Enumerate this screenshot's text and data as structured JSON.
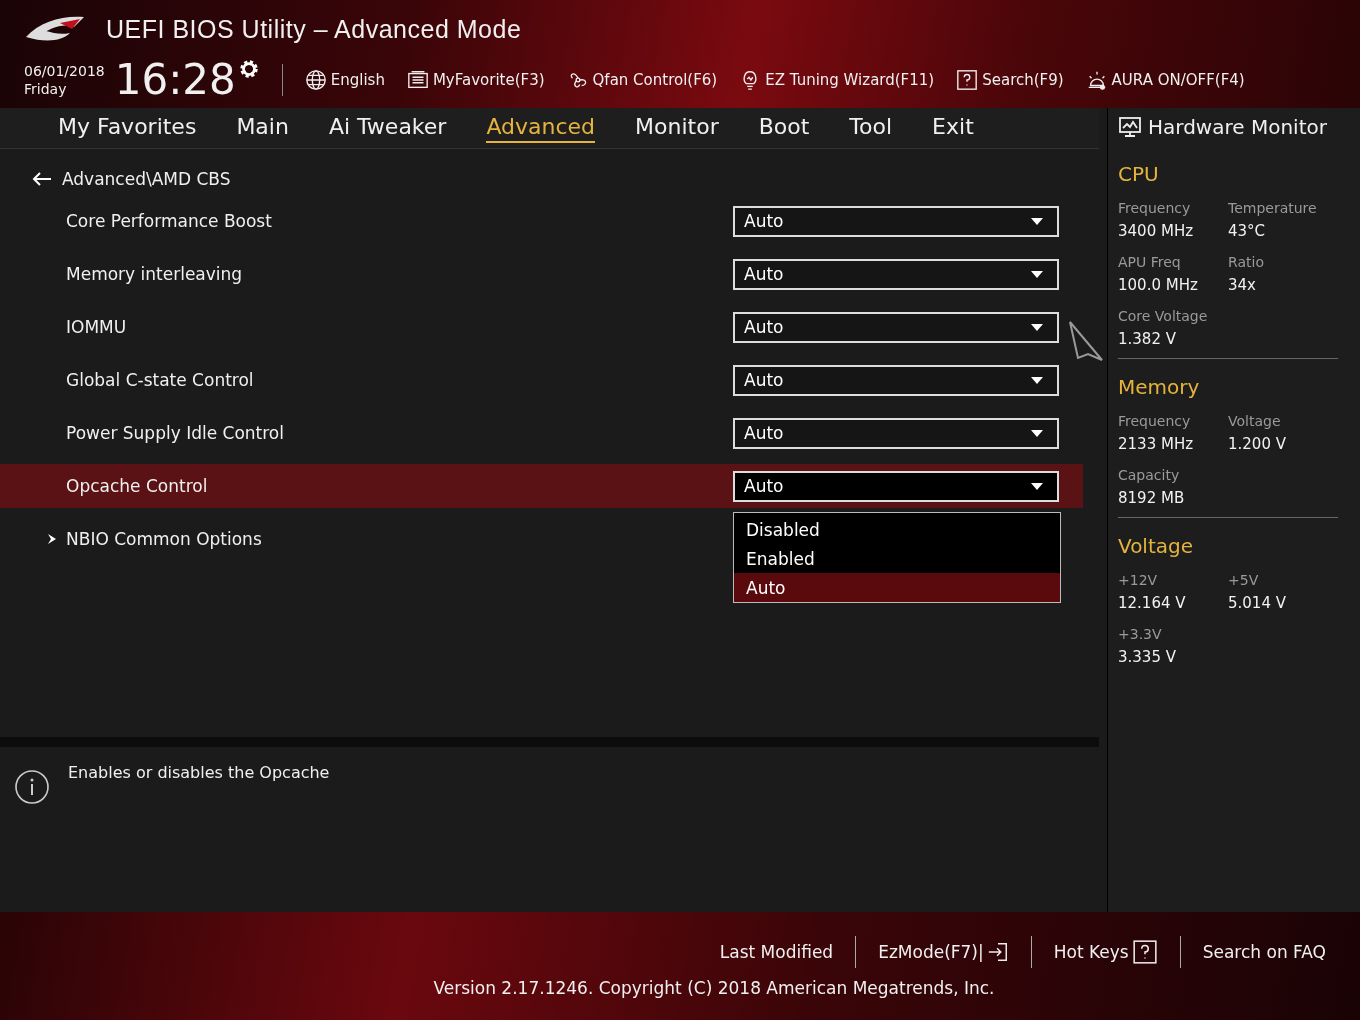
{
  "window": {
    "title": "UEFI BIOS Utility – Advanced Mode"
  },
  "clock": {
    "date": "06/01/2018",
    "day": "Friday",
    "time": "16:28"
  },
  "toolbar": [
    {
      "kind": "language",
      "label": "English"
    },
    {
      "kind": "favorite",
      "label": "MyFavorite(F3)"
    },
    {
      "kind": "fan",
      "label": "Qfan Control(F6)"
    },
    {
      "kind": "wizard",
      "label": "EZ Tuning Wizard(F11)"
    },
    {
      "kind": "search",
      "label": "Search(F9)"
    },
    {
      "kind": "aura",
      "label": "AURA ON/OFF(F4)"
    }
  ],
  "tabs": [
    {
      "label": "My Favorites",
      "selected": false
    },
    {
      "label": "Main",
      "selected": false
    },
    {
      "label": "Ai Tweaker",
      "selected": false
    },
    {
      "label": "Advanced",
      "selected": true
    },
    {
      "label": "Monitor",
      "selected": false
    },
    {
      "label": "Boot",
      "selected": false
    },
    {
      "label": "Tool",
      "selected": false
    },
    {
      "label": "Exit",
      "selected": false
    }
  ],
  "breadcrumb": "Advanced\\AMD CBS",
  "settings": [
    {
      "kind": "dropdown",
      "label": "Core Performance Boost",
      "value": "Auto",
      "selected": false,
      "expanded": false
    },
    {
      "kind": "dropdown",
      "label": "Memory interleaving",
      "value": "Auto",
      "selected": false,
      "expanded": false
    },
    {
      "kind": "dropdown",
      "label": "IOMMU",
      "value": "Auto",
      "selected": false,
      "expanded": false
    },
    {
      "kind": "dropdown",
      "label": "Global C-state Control",
      "value": "Auto",
      "selected": false,
      "expanded": false
    },
    {
      "kind": "dropdown",
      "label": "Power Supply Idle Control",
      "value": "Auto",
      "selected": false,
      "expanded": false
    },
    {
      "kind": "dropdown",
      "label": "Opcache Control",
      "value": "Auto",
      "selected": true,
      "expanded": true,
      "options": [
        {
          "label": "Disabled",
          "selected": false
        },
        {
          "label": "Enabled",
          "selected": false
        },
        {
          "label": "Auto",
          "selected": true
        }
      ]
    },
    {
      "kind": "submenu",
      "label": "NBIO Common Options",
      "selected": false
    }
  ],
  "help": "Enables or disables the Opcache",
  "hardware_monitor": {
    "title": "Hardware Monitor",
    "sections": [
      {
        "title": "CPU",
        "readings": [
          {
            "label": "Frequency",
            "value": "3400 MHz"
          },
          {
            "label": "Temperature",
            "value": "43°C"
          },
          {
            "label": "APU Freq",
            "value": "100.0 MHz"
          },
          {
            "label": "Ratio",
            "value": "34x"
          },
          {
            "label": "Core Voltage",
            "value": "1.382 V"
          }
        ]
      },
      {
        "title": "Memory",
        "readings": [
          {
            "label": "Frequency",
            "value": "2133 MHz"
          },
          {
            "label": "Voltage",
            "value": "1.200 V"
          },
          {
            "label": "Capacity",
            "value": "8192 MB"
          }
        ]
      },
      {
        "title": "Voltage",
        "readings": [
          {
            "label": "+12V",
            "value": "12.164 V"
          },
          {
            "label": "+5V",
            "value": "5.014 V"
          },
          {
            "label": "+3.3V",
            "value": "3.335 V"
          }
        ]
      }
    ]
  },
  "footer": {
    "actions": [
      {
        "kind": "plain",
        "label": "Last Modified"
      },
      {
        "kind": "ezmode",
        "label": "EzMode(F7)|"
      },
      {
        "kind": "hotkeys",
        "label": "Hot Keys"
      },
      {
        "kind": "plain",
        "label": "Search on FAQ"
      }
    ],
    "version": "Version 2.17.1246. Copyright (C) 2018 American Megatrends, Inc."
  }
}
